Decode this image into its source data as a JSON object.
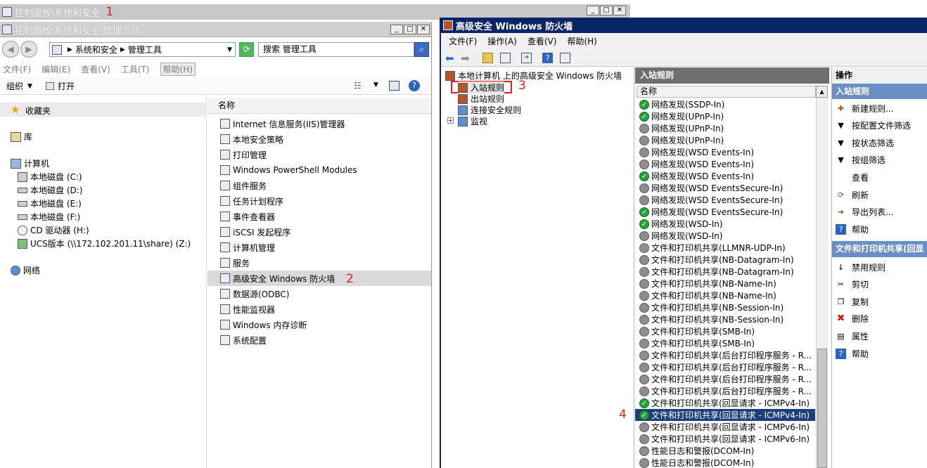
{
  "background_window": {
    "title": "控制面板\\系统和安全",
    "marker": "1",
    "menu": {
      "file": "文件(F)",
      "edit": "编辑(E)",
      "view": "查看(V)",
      "tools": "工具(T)",
      "help": "帮助(H)"
    }
  },
  "explorer": {
    "title": "控制面板\\系统和安全\\管理工具",
    "address": {
      "segments": [
        "系统和安全",
        "管理工具"
      ]
    },
    "search": {
      "placeholder": "搜索 管理工具"
    },
    "menu": {
      "file": "文件(F)",
      "edit": "编辑(E)",
      "view": "查看(V)",
      "tools": "工具(T)",
      "help": "帮助(H)"
    },
    "toolbar": {
      "organize": "组织",
      "open": "打开"
    },
    "nav": {
      "favorites": "收藏夹",
      "libraries": "库",
      "computer": "计算机",
      "drives": [
        "本地磁盘 (C:)",
        "本地磁盘 (D:)",
        "本地磁盘 (E:)",
        "本地磁盘 (F:)",
        "CD 驱动器 (H:)",
        "UCS版本 (\\\\172.102.201.11\\share) (Z:)"
      ],
      "network": "网络"
    },
    "list": {
      "header": "名称",
      "items": [
        "Internet 信息服务(IIS)管理器",
        "本地安全策略",
        "打印管理",
        "Windows PowerShell Modules",
        "组件服务",
        "任务计划程序",
        "事件查看器",
        "iSCSI 发起程序",
        "计算机管理",
        "服务",
        "高级安全 Windows 防火墙",
        "数据源(ODBC)",
        "性能监视器",
        "Windows 内存诊断",
        "系统配置"
      ],
      "selected_index": 10,
      "marker": "2"
    }
  },
  "firewall": {
    "title": "高级安全 Windows 防火墙",
    "menu": {
      "file": "文件(F)",
      "action": "操作(A)",
      "view": "查看(V)",
      "help": "帮助(H)"
    },
    "tree": {
      "root": "本地计算机 上的高级安全 Windows 防火墙",
      "inbound": "入站规则",
      "outbound": "出站规则",
      "connection": "连接安全规则",
      "monitor": "监视",
      "marker": "3"
    },
    "rules": {
      "title": "入站规则",
      "header": "名称",
      "marker": "4",
      "selected_index": 26,
      "items": [
        {
          "name": "网络发现(SSDP-In)",
          "enabled": true
        },
        {
          "name": "网络发现(UPnP-In)",
          "enabled": true
        },
        {
          "name": "网络发现(UPnP-In)",
          "enabled": false
        },
        {
          "name": "网络发现(UPnP-In)",
          "enabled": false
        },
        {
          "name": "网络发现(WSD Events-In)",
          "enabled": false
        },
        {
          "name": "网络发现(WSD Events-In)",
          "enabled": false
        },
        {
          "name": "网络发现(WSD Events-In)",
          "enabled": true
        },
        {
          "name": "网络发现(WSD EventsSecure-In)",
          "enabled": false
        },
        {
          "name": "网络发现(WSD EventsSecure-In)",
          "enabled": false
        },
        {
          "name": "网络发现(WSD EventsSecure-In)",
          "enabled": true
        },
        {
          "name": "网络发现(WSD-In)",
          "enabled": true
        },
        {
          "name": "网络发现(WSD-In)",
          "enabled": false
        },
        {
          "name": "文件和打印机共享(LLMNR-UDP-In)",
          "enabled": false
        },
        {
          "name": "文件和打印机共享(NB-Datagram-In)",
          "enabled": false
        },
        {
          "name": "文件和打印机共享(NB-Datagram-In)",
          "enabled": false
        },
        {
          "name": "文件和打印机共享(NB-Name-In)",
          "enabled": false
        },
        {
          "name": "文件和打印机共享(NB-Name-In)",
          "enabled": false
        },
        {
          "name": "文件和打印机共享(NB-Session-In)",
          "enabled": false
        },
        {
          "name": "文件和打印机共享(NB-Session-In)",
          "enabled": false
        },
        {
          "name": "文件和打印机共享(SMB-In)",
          "enabled": false
        },
        {
          "name": "文件和打印机共享(SMB-In)",
          "enabled": false
        },
        {
          "name": "文件和打印机共享(后台打印程序服务 - R...",
          "enabled": false
        },
        {
          "name": "文件和打印机共享(后台打印程序服务 - R...",
          "enabled": false
        },
        {
          "name": "文件和打印机共享(后台打印程序服务 - R...",
          "enabled": false
        },
        {
          "name": "文件和打印机共享(后台打印程序服务 - R...",
          "enabled": false
        },
        {
          "name": "文件和打印机共享(回显请求 - ICMPv4-In)",
          "enabled": true
        },
        {
          "name": "文件和打印机共享(回显请求 - ICMPv4-In)",
          "enabled": true
        },
        {
          "name": "文件和打印机共享(回显请求 - ICMPv6-In)",
          "enabled": false
        },
        {
          "name": "文件和打印机共享(回显请求 - ICMPv6-In)",
          "enabled": false
        },
        {
          "name": "性能日志和警报(DCOM-In)",
          "enabled": false
        },
        {
          "name": "性能日志和警报(DCOM-In)",
          "enabled": false
        }
      ]
    },
    "actions": {
      "header": "操作",
      "section1": "入站规则",
      "items1": [
        {
          "label": "新建规则...",
          "icon": "new-rule-icon"
        },
        {
          "label": "按配置文件筛选",
          "icon": "filter-icon"
        },
        {
          "label": "按状态筛选",
          "icon": "filter-icon"
        },
        {
          "label": "按组筛选",
          "icon": "filter-icon"
        },
        {
          "label": "查看",
          "icon": "view-icon"
        },
        {
          "label": "刷新",
          "icon": "refresh-icon"
        },
        {
          "label": "导出列表...",
          "icon": "export-icon"
        },
        {
          "label": "帮助",
          "icon": "help-icon"
        }
      ],
      "section2": "文件和打印机共享(回显",
      "items2": [
        {
          "label": "禁用规则",
          "icon": "disable-icon"
        },
        {
          "label": "剪切",
          "icon": "cut-icon"
        },
        {
          "label": "复制",
          "icon": "copy-icon"
        },
        {
          "label": "删除",
          "icon": "delete-icon"
        },
        {
          "label": "属性",
          "icon": "properties-icon"
        },
        {
          "label": "帮助",
          "icon": "help-icon"
        }
      ]
    }
  },
  "colors": {
    "titlebar_inactive": "#c8c8c8",
    "titlebar_active": "#0a246a",
    "selection": "#1a3f7a",
    "hover_row": "#d9d9d9",
    "marker": "#dd2222",
    "enabled_icon": "#27a13a",
    "disabled_icon": "#8d8d8d"
  }
}
